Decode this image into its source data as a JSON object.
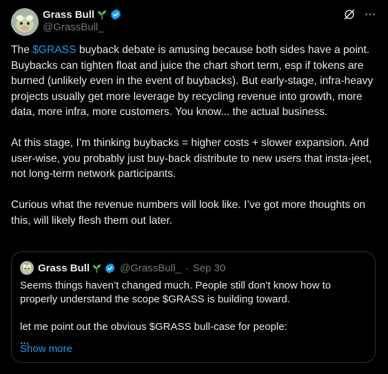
{
  "author": {
    "name": "Grass Bull",
    "handle": "@GrassBull_"
  },
  "icons": {
    "sprout": "sprout-icon",
    "verified": "verified-badge-icon",
    "grok": "grok-icon",
    "more": "more-icon"
  },
  "colors": {
    "background": "#000000",
    "text": "#e7e9ea",
    "secondary": "#71767b",
    "link": "#1d9bf0",
    "verified": "#1d9bf0",
    "border": "#2f3336",
    "sprout": "#57b846"
  },
  "post": {
    "p1_a": "The ",
    "cashtag": "$GRASS",
    "p1_b": " buyback debate is amusing because both sides have a point. Buybacks can tighten float and juice the chart short term, esp if tokens are burned (unlikely even in the event of buybacks). But early-stage, infra-heavy projects usually get more leverage by recycling revenue into growth, more data, more infra, more customers. You know... the actual business.",
    "p2": "At this stage, I’m thinking buybacks = higher costs + slower expansion. And user-wise, you probably just buy-back distribute to new users that insta-jeet, not long-term network participants.",
    "p3": "Curious what the revenue numbers will look like. I’ve got more thoughts on this, will likely flesh them out later."
  },
  "quote": {
    "name": "Grass Bull",
    "handle": "@GrassBull_",
    "separator": "·",
    "date": "Sep 30",
    "p1": "Seems things haven’t changed much. People still don’t know how to properly understand the scope $GRASS is building toward.",
    "p2": "let me point out the obvious $GRASS bull-case for people:",
    "ellipsis": "...",
    "show_more": "Show more"
  }
}
